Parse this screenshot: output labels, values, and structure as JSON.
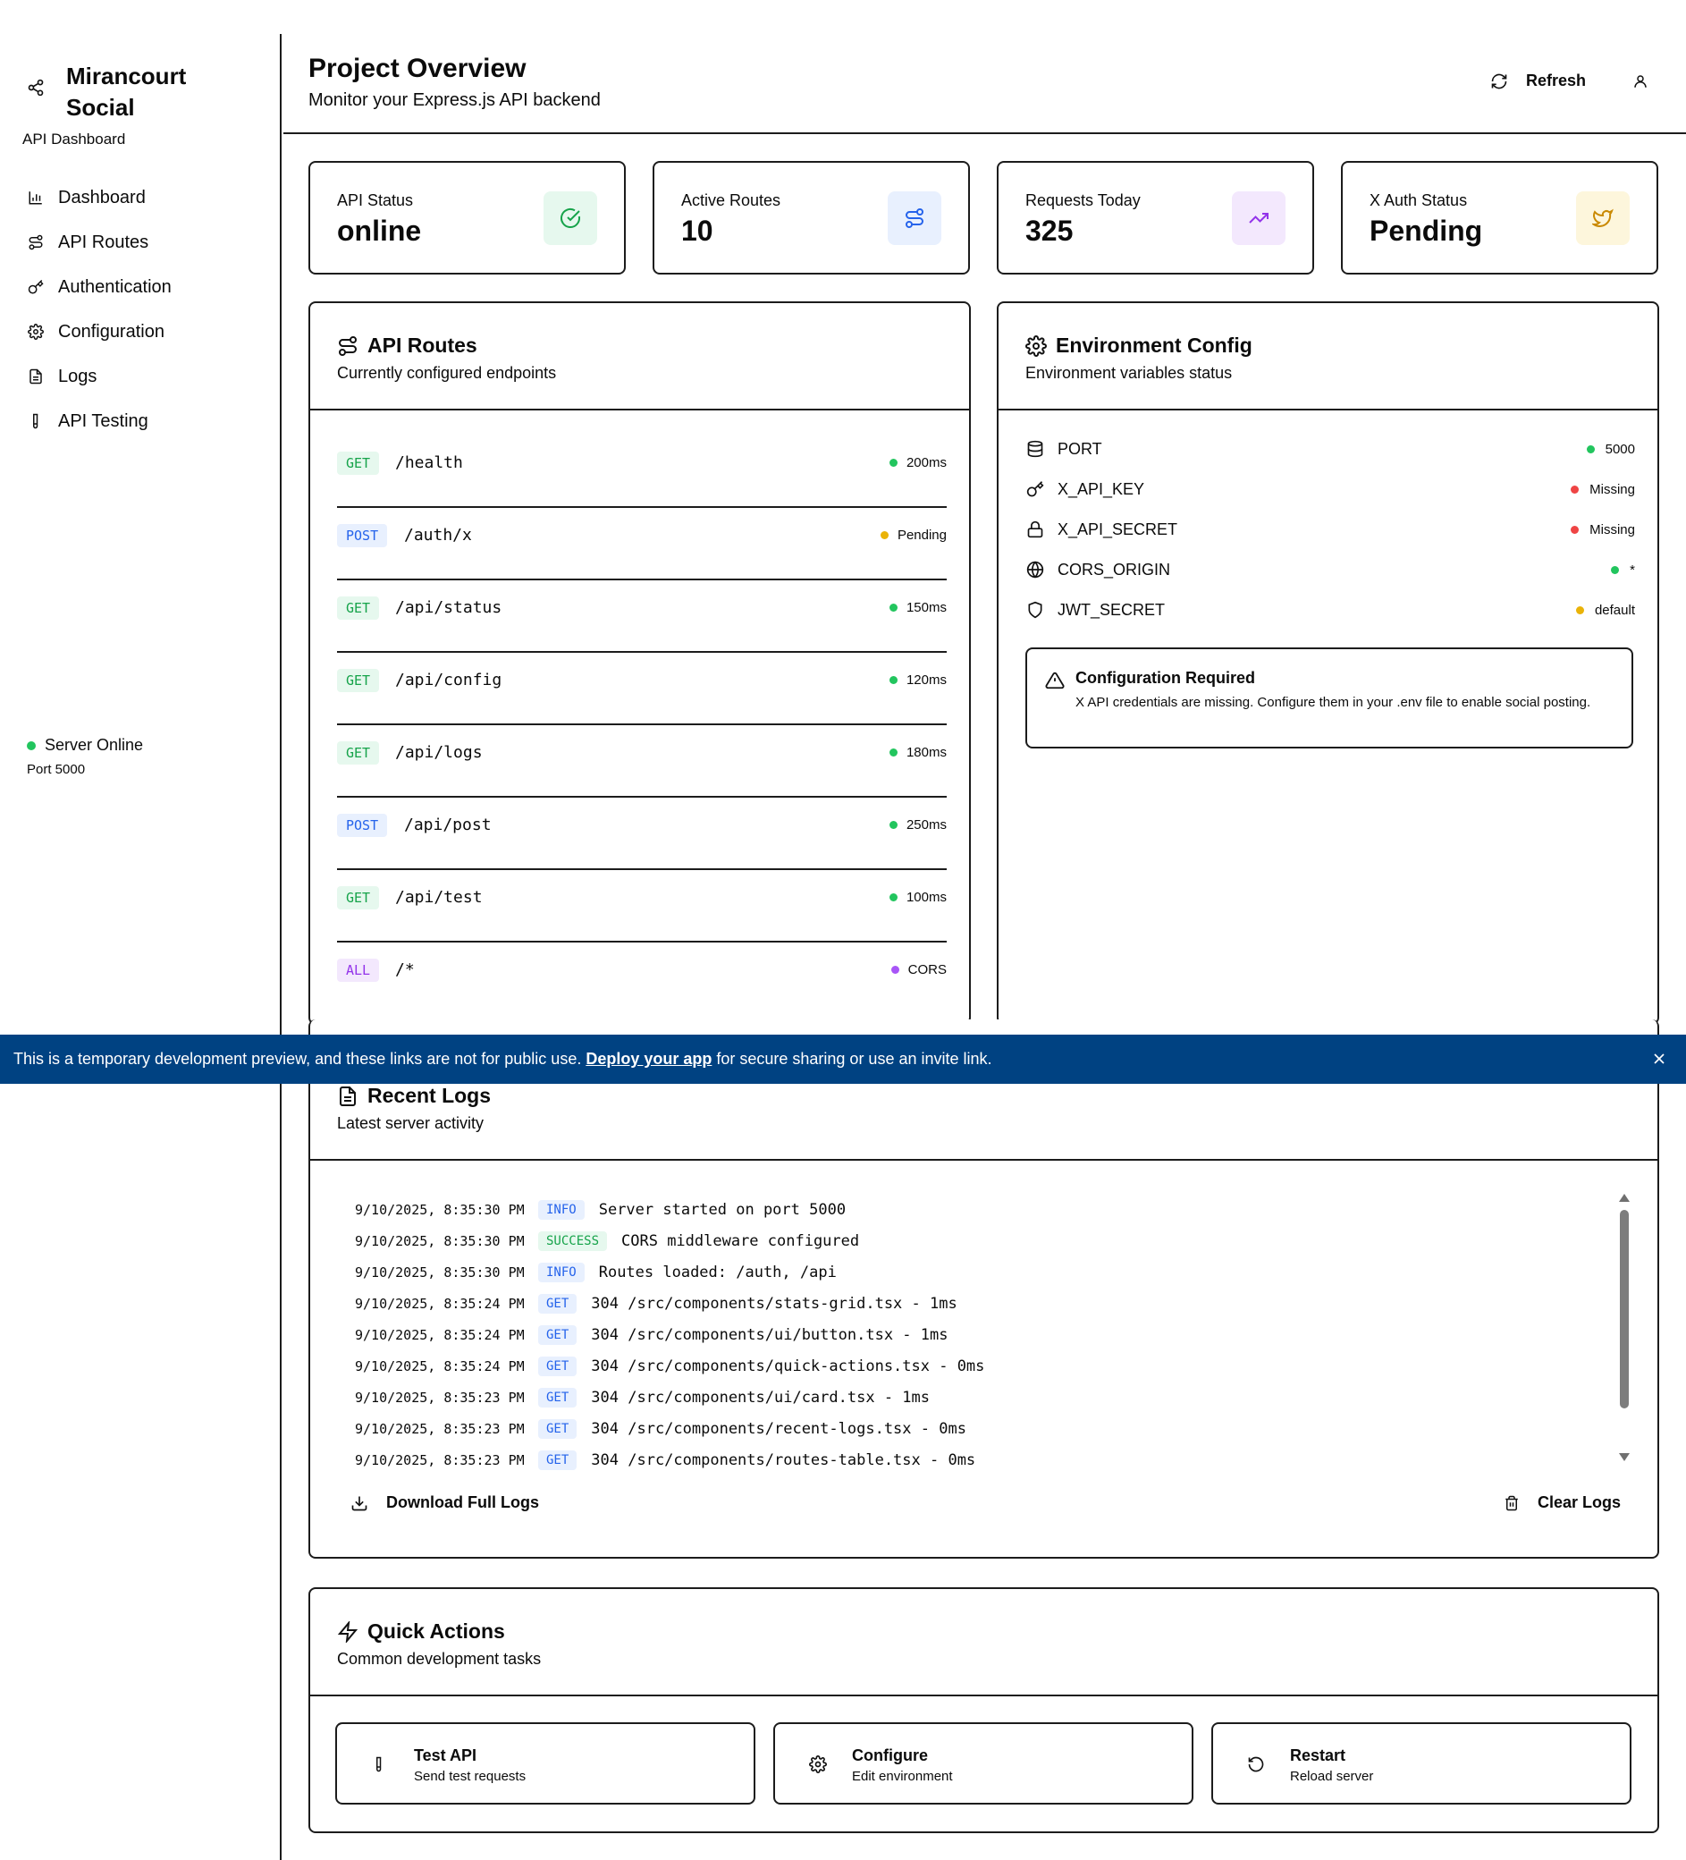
{
  "sidebar": {
    "brand_title": "Mirancourt Social",
    "brand_subtitle": "API Dashboard",
    "nav": [
      {
        "label": "Dashboard",
        "icon": "bar-chart-icon"
      },
      {
        "label": "API Routes",
        "icon": "route-icon"
      },
      {
        "label": "Authentication",
        "icon": "key-icon"
      },
      {
        "label": "Configuration",
        "icon": "gear-icon"
      },
      {
        "label": "Logs",
        "icon": "document-icon"
      },
      {
        "label": "API Testing",
        "icon": "test-tube-icon"
      }
    ],
    "server_status": "Server Online",
    "server_port": "Port 5000"
  },
  "header": {
    "title": "Project Overview",
    "subtitle": "Monitor your Express.js API backend",
    "refresh_label": "Refresh"
  },
  "stats": [
    {
      "label": "API Status",
      "value": "online",
      "icon": "check-circle-icon",
      "accent": "#16a34a",
      "bg": "#e6f8ee"
    },
    {
      "label": "Active Routes",
      "value": "10",
      "icon": "route-icon",
      "accent": "#2563eb",
      "bg": "#e8f0fe"
    },
    {
      "label": "Requests Today",
      "value": "325",
      "icon": "trending-up-icon",
      "accent": "#9333ea",
      "bg": "#f3e8fd"
    },
    {
      "label": "X Auth Status",
      "value": "Pending",
      "icon": "twitter-icon",
      "accent": "#ca8a04",
      "bg": "#fdf6dc"
    }
  ],
  "routes_panel": {
    "title": "API Routes",
    "subtitle": "Currently configured endpoints",
    "routes": [
      {
        "method": "GET",
        "path": "/health",
        "status": "200ms",
        "dot": "#22c55e"
      },
      {
        "method": "POST",
        "path": "/auth/x",
        "status": "Pending",
        "dot": "#eab308"
      },
      {
        "method": "GET",
        "path": "/api/status",
        "status": "150ms",
        "dot": "#22c55e"
      },
      {
        "method": "GET",
        "path": "/api/config",
        "status": "120ms",
        "dot": "#22c55e"
      },
      {
        "method": "GET",
        "path": "/api/logs",
        "status": "180ms",
        "dot": "#22c55e"
      },
      {
        "method": "POST",
        "path": "/api/post",
        "status": "250ms",
        "dot": "#22c55e"
      },
      {
        "method": "GET",
        "path": "/api/test",
        "status": "100ms",
        "dot": "#22c55e"
      },
      {
        "method": "ALL",
        "path": "/*",
        "status": "CORS",
        "dot": "#a855f7"
      }
    ]
  },
  "env_panel": {
    "title": "Environment Config",
    "subtitle": "Environment variables status",
    "vars": [
      {
        "name": "PORT",
        "value": "5000",
        "icon": "database-icon",
        "dot": "#22c55e"
      },
      {
        "name": "X_API_KEY",
        "value": "Missing",
        "icon": "key-icon",
        "dot": "#ef4444"
      },
      {
        "name": "X_API_SECRET",
        "value": "Missing",
        "icon": "lock-icon",
        "dot": "#ef4444"
      },
      {
        "name": "CORS_ORIGIN",
        "value": "*",
        "icon": "globe-icon",
        "dot": "#22c55e"
      },
      {
        "name": "JWT_SECRET",
        "value": "default",
        "icon": "shield-icon",
        "dot": "#eab308"
      }
    ],
    "alert_title": "Configuration Required",
    "alert_text": "X API credentials are missing. Configure them in your .env file to enable social posting."
  },
  "banner": {
    "text_before": "This is a temporary development preview, and these links are not for public use.",
    "link": "Deploy your app",
    "text_after": "for secure sharing or use an invite link."
  },
  "logs_panel": {
    "title": "Recent Logs",
    "subtitle": "Latest server activity",
    "entries": [
      {
        "ts": "9/10/2025, 8:35:30 PM",
        "tag": "INFO",
        "msg": "Server started on port 5000"
      },
      {
        "ts": "9/10/2025, 8:35:30 PM",
        "tag": "SUCCESS",
        "msg": "CORS middleware configured"
      },
      {
        "ts": "9/10/2025, 8:35:30 PM",
        "tag": "INFO",
        "msg": "Routes loaded: /auth, /api"
      },
      {
        "ts": "9/10/2025, 8:35:24 PM",
        "tag": "GET",
        "msg": "304 /src/components/stats-grid.tsx - 1ms"
      },
      {
        "ts": "9/10/2025, 8:35:24 PM",
        "tag": "GET",
        "msg": "304 /src/components/ui/button.tsx - 1ms"
      },
      {
        "ts": "9/10/2025, 8:35:24 PM",
        "tag": "GET",
        "msg": "304 /src/components/quick-actions.tsx - 0ms"
      },
      {
        "ts": "9/10/2025, 8:35:23 PM",
        "tag": "GET",
        "msg": "304 /src/components/ui/card.tsx - 1ms"
      },
      {
        "ts": "9/10/2025, 8:35:23 PM",
        "tag": "GET",
        "msg": "304 /src/components/recent-logs.tsx - 0ms"
      },
      {
        "ts": "9/10/2025, 8:35:23 PM",
        "tag": "GET",
        "msg": "304 /src/components/routes-table.tsx - 0ms"
      }
    ],
    "download_label": "Download Full Logs",
    "clear_label": "Clear Logs"
  },
  "quick_actions": {
    "title": "Quick Actions",
    "subtitle": "Common development tasks",
    "buttons": [
      {
        "title": "Test API",
        "sub": "Send test requests",
        "icon": "test-tube-icon"
      },
      {
        "title": "Configure",
        "sub": "Edit environment",
        "icon": "gear-icon"
      },
      {
        "title": "Restart",
        "sub": "Reload server",
        "icon": "rotate-ccw-icon"
      }
    ]
  }
}
